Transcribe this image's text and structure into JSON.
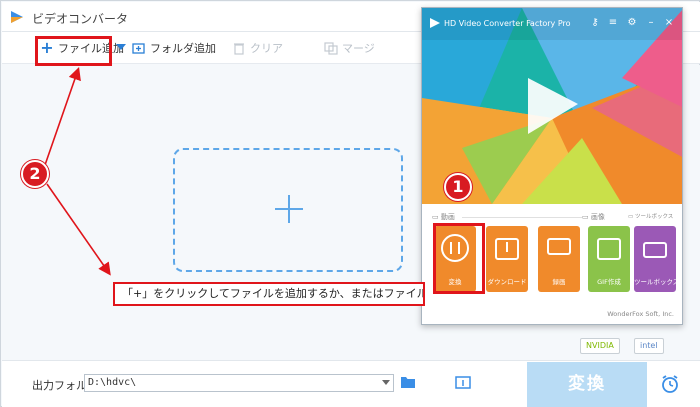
{
  "window": {
    "title": "ビデオコンバータ"
  },
  "toolbar": {
    "add_file_label": "ファイル追加",
    "add_folder_label": "フォルダ追加",
    "clear_label": "クリア",
    "merge_label": "マージ"
  },
  "dropzone": {
    "hint": "「+」をクリックしてファイルを追加するか、またはファイルをここまでドラッグ"
  },
  "output": {
    "label": "出力フォルダ：",
    "path": "D:\\hdvc\\"
  },
  "convert_button_label": "変換",
  "launcher": {
    "title": "HD Video Converter Factory Pro",
    "section_video": "動画",
    "section_image": "画像",
    "section_toolbox": "ツールボックス",
    "tiles": [
      {
        "label": "変換",
        "color": "#f08a2b",
        "icon": "film-icon"
      },
      {
        "label": "ダウンロード",
        "color": "#f08a2b",
        "icon": "download-icon"
      },
      {
        "label": "録画",
        "color": "#f08a2b",
        "icon": "screen-record-icon"
      },
      {
        "label": "GIF作成",
        "color": "#8bc34a",
        "icon": "image-icon"
      },
      {
        "label": "ツールボックス",
        "color": "#9b59b6",
        "icon": "toolbox-icon"
      }
    ],
    "footer": "WonderFox Soft, Inc."
  },
  "gpu": {
    "nvidia": "NVIDIA",
    "intel": "intel"
  },
  "annotations": {
    "step1": "1",
    "step2": "2"
  },
  "colors": {
    "accent": "#2a7fd6",
    "annotation_red": "#e0151b",
    "convert_disabled": "#b9dcf5"
  }
}
